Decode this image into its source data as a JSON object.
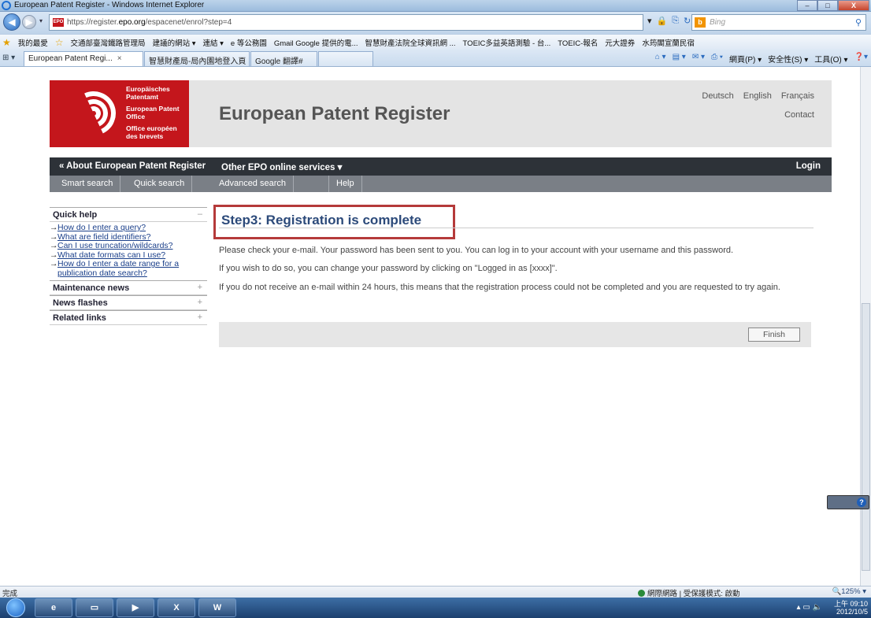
{
  "window": {
    "title": "European Patent Register - Windows Internet Explorer",
    "minimize": "–",
    "maximize": "□",
    "close": "X"
  },
  "address": {
    "url_prefix": "https://register.",
    "url_domain": "epo.org",
    "url_path": "/espacenet/enrol?step=4",
    "favicon_label": "EPO",
    "search_placeholder": "Bing"
  },
  "favorites": {
    "label": "我的最愛",
    "links": [
      "交通部臺灣鐵路管理局",
      "建議的網站 ▾",
      "連結 ▾",
      "e 等公務園",
      "Gmail Google 提供的電...",
      "智慧財產法院全球資訊網 ...",
      "TOEIC多益英語測驗 - 台...",
      "TOEIC-報名",
      "元大證券",
      "水筠閣宣蘭民宿"
    ]
  },
  "tabs": [
    {
      "label": "European Patent Regi...",
      "close": "×"
    },
    {
      "label": "智慧財產局-局內園地登入頁"
    },
    {
      "label": "Google 翻譯#"
    }
  ],
  "command_bar": [
    "網頁(P) ▾",
    "安全性(S) ▾",
    "工具(O) ▾"
  ],
  "site": {
    "logo_lines": [
      "Europäisches Patentamt",
      "European Patent Office",
      "Office européen des brevets"
    ],
    "title": "European Patent Register",
    "languages": [
      "Deutsch",
      "English",
      "Français"
    ],
    "contact": "Contact",
    "nav": {
      "about": "« About European Patent Register",
      "other": "Other EPO online services ▾",
      "login": "Login"
    },
    "subnav": [
      "Smart search",
      "Quick search",
      "Advanced search",
      "",
      "Help"
    ]
  },
  "sidebar": {
    "quick_help": {
      "title": "Quick help",
      "toggle": "–",
      "links": [
        "How do I enter a query?",
        "What are field identifiers?",
        "Can I use truncation/wildcards?",
        "What date formats can I use?",
        "How do I enter a date range for a publication date search?"
      ]
    },
    "sections": [
      {
        "title": "Maintenance news",
        "toggle": "+"
      },
      {
        "title": "News flashes",
        "toggle": "+"
      },
      {
        "title": "Related links",
        "toggle": "+"
      }
    ]
  },
  "main": {
    "step_title": "Step3: Registration is complete",
    "paragraphs": [
      "Please check your e-mail. Your password has been sent to you. You can log in to your account with your username and this password.",
      "If you wish to do so, you can change your password by clicking on \"Logged in as [xxxx]\".",
      "If you do not receive an e-mail within 24 hours, this means that the registration process could not be completed and you are requested to try again."
    ],
    "finish_label": "Finish"
  },
  "status": {
    "left": "完成",
    "zone": "網際網路 | 受保護模式: 啟動",
    "zoom": "🔍125% ▾"
  },
  "taskbar": {
    "time": "上午 09:10",
    "date": "2012/10/5"
  },
  "colors": {
    "epo_red": "#c4161c",
    "nav_dark": "#2d3238",
    "subnav_gray": "#7a7f86",
    "highlight": "#b53a3a",
    "title_blue": "#2c4a7a"
  }
}
